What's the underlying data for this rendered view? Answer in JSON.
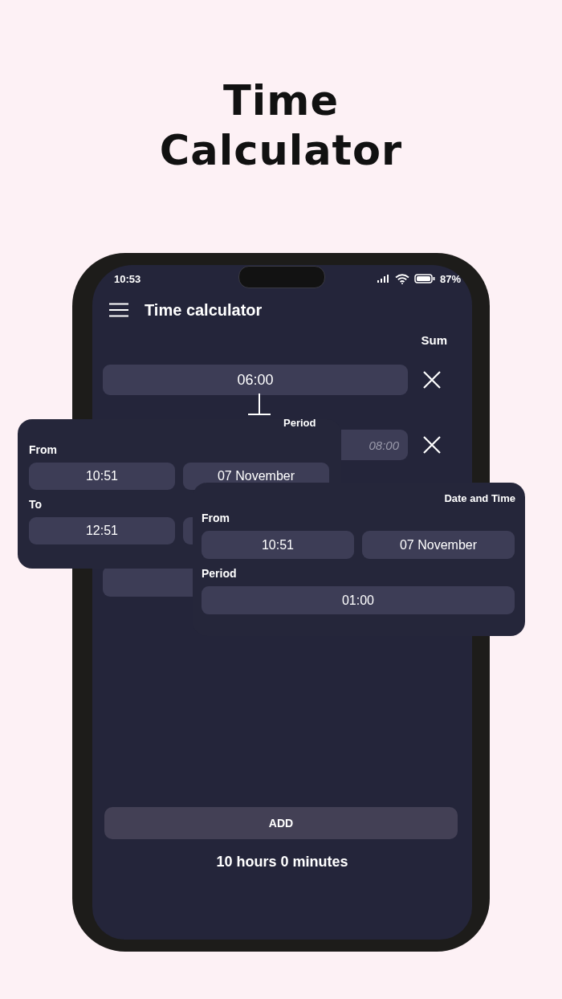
{
  "headline": "Time Calculator",
  "status_bar": {
    "time": "10:53",
    "battery": "87%"
  },
  "app_bar": {
    "title": "Time calculator"
  },
  "screen": {
    "mode_label": "Sum",
    "entries": [
      {
        "value": "06:00"
      }
    ],
    "period_label": "Period",
    "period_entry": {
      "placeholder": "08:00"
    },
    "add_button": "ADD",
    "result": "10 hours 0 minutes"
  },
  "from_to_card": {
    "from_label": "From",
    "from_time": "10:51",
    "from_date": "07 November",
    "to_label": "To",
    "to_time": "12:51"
  },
  "date_time_card": {
    "title": "Date and Time",
    "from_label": "From",
    "from_time": "10:51",
    "from_date": "07 November",
    "period_label": "Period",
    "period": "01:00"
  }
}
